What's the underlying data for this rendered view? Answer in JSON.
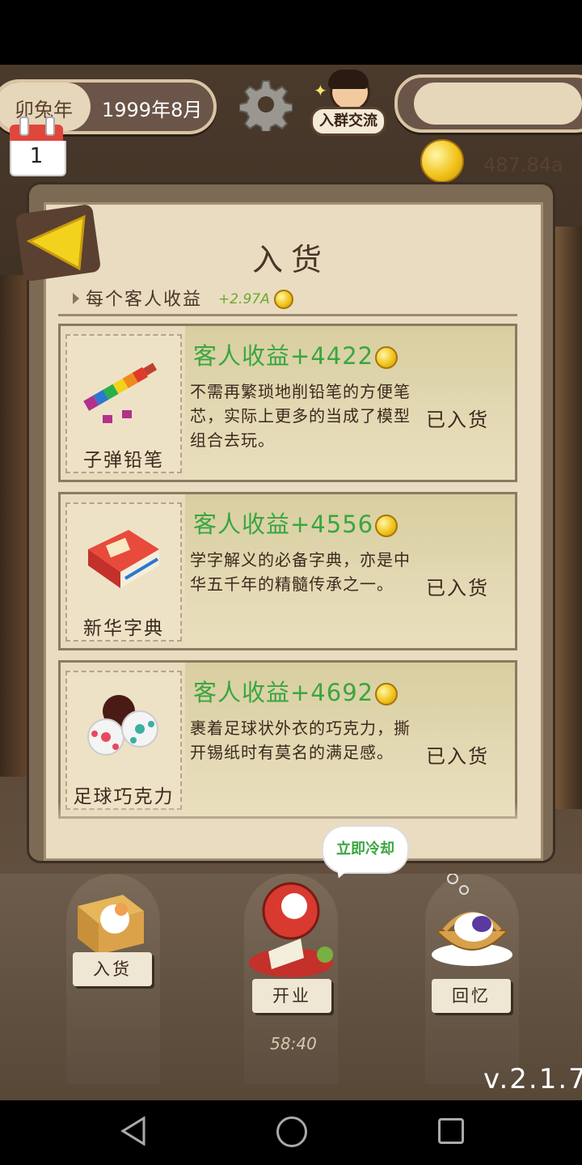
{
  "header": {
    "zodiac_year": "卯兔年",
    "date": "1999年8月",
    "calendar_day": "1",
    "group_chat_label": "入群交流",
    "coins": "487.84a"
  },
  "shop": {
    "title": "入货",
    "income_label": "每个客人收益",
    "income_value": "+2.97A",
    "items": [
      {
        "name": "子弹铅笔",
        "gain": "客人收益+4422",
        "description": "不需再繁琐地削铅笔的方便笔芯，实际上更多的当成了模型组合去玩。",
        "status": "已入货"
      },
      {
        "name": "新华字典",
        "gain": "客人收益+4556",
        "description": "学字解义的必备字典，亦是中华五千年的精髓传承之一。",
        "status": "已入货"
      },
      {
        "name": "足球巧克力",
        "gain": "客人收益+4692",
        "description": "裹着足球状外衣的巧克力，撕开锡纸时有莫名的满足感。",
        "status": "已入货"
      }
    ]
  },
  "bottom": {
    "stock_label": "入货",
    "open_label": "开业",
    "memory_label": "回忆",
    "cooldown_bubble": "立即冷却",
    "timer": "58:40",
    "version": "v.2.1.7"
  },
  "colors": {
    "gain_green": "#3aa640",
    "panel_bg": "#eadcc1",
    "coin_gold": "#f2c41c"
  }
}
